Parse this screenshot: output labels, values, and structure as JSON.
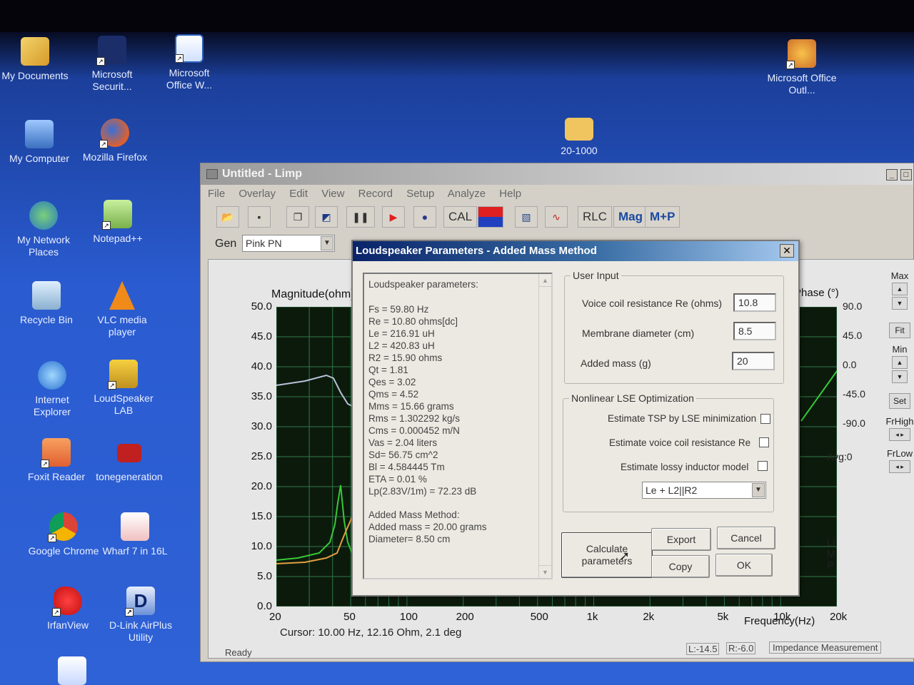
{
  "desktop": {
    "icons": [
      {
        "label": "My Documents"
      },
      {
        "label": "Microsoft Securit..."
      },
      {
        "label": "Microsoft Office W..."
      },
      {
        "label": "Microsoft Office Outl..."
      },
      {
        "label": "My Computer"
      },
      {
        "label": "Mozilla Firefox"
      },
      {
        "label": "20-1000"
      },
      {
        "label": "My Network Places"
      },
      {
        "label": "Notepad++"
      },
      {
        "label": "Recycle Bin"
      },
      {
        "label": "VLC media player"
      },
      {
        "label": "Internet Explorer"
      },
      {
        "label": "LoudSpeaker LAB"
      },
      {
        "label": "Foxit Reader"
      },
      {
        "label": "tonegeneration"
      },
      {
        "label": "Google Chrome"
      },
      {
        "label": "Wharf 7 in 16L"
      },
      {
        "label": "IrfanView"
      },
      {
        "label": "D-Link AirPlus Utility"
      }
    ]
  },
  "main_window": {
    "title": "Untitled - Limp",
    "menu": [
      "File",
      "Overlay",
      "Edit",
      "View",
      "Record",
      "Setup",
      "Analyze",
      "Help"
    ],
    "toolbar": {
      "cal": "CAL",
      "rlc": "RLC",
      "mag": "Mag",
      "mp": "M+P"
    },
    "gen_label": "Gen",
    "gen_value": "Pink PN",
    "plot": {
      "y_title": "Magnitude(ohm)",
      "phase_title": "Phase (°)",
      "y_ticks": [
        "50.0",
        "45.0",
        "40.0",
        "35.0",
        "30.0",
        "25.0",
        "20.0",
        "15.0",
        "10.0",
        "5.0",
        "0.0"
      ],
      "phase_ticks": [
        "90.0",
        "45.0",
        "0.0",
        "-45.0",
        "-90.0"
      ],
      "avg": "Avg:0",
      "x_ticks": [
        "20",
        "50",
        "100",
        "200",
        "500",
        "1k",
        "2k",
        "5k",
        "10k",
        "20k"
      ],
      "x_title": "Frequency(Hz)",
      "cursor": "Cursor: 10.00 Hz, 12.16 Ohm, 2.1 deg",
      "limp_vertical": "LIMP"
    },
    "side": {
      "max": "Max",
      "fit": "Fit",
      "min": "Min",
      "set": "Set",
      "frhigh": "FrHigh",
      "frlow": "FrLow"
    },
    "status": {
      "ready": "Ready",
      "l": "L:-14.5",
      "r": "R:-6.0",
      "mode": "Impedance Measurement"
    }
  },
  "dialog": {
    "title": "Loudspeaker Parameters - Added Mass Method",
    "close": "✕",
    "params_header": "Loudspeaker parameters:",
    "params": [
      "Fs  = 59.80 Hz",
      "Re  = 10.80 ohms[dc]",
      "Le  = 216.91 uH",
      "L2  = 420.83 uH",
      "R2  = 15.90 ohms",
      "Qt  = 1.81",
      "Qes = 3.02",
      "Qms = 4.52",
      "Mms = 15.66 grams",
      "Rms = 1.302292 kg/s",
      "Cms = 0.000452 m/N",
      "Vas = 2.04 liters",
      "Sd= 56.75 cm^2",
      "Bl  = 4.584445 Tm",
      "ETA = 0.01 %",
      "Lp(2.83V/1m) = 72.23 dB"
    ],
    "method_lines": [
      "Added Mass Method:",
      "Added mass = 20.00 grams",
      "Diameter= 8.50 cm"
    ],
    "user_input": {
      "legend": "User Input",
      "re_label": "Voice coil resistance Re (ohms)",
      "re_value": "10.8",
      "diam_label": "Membrane diameter (cm)",
      "diam_value": "8.5",
      "mass_label": "Added mass (g)",
      "mass_value": "20"
    },
    "lse": {
      "legend": "Nonlinear LSE Optimization",
      "opt1": "Estimate TSP by LSE minimization",
      "opt2": "Estimate voice coil resistance Re",
      "opt3": "Estimate lossy inductor model",
      "model": "Le + L2||R2"
    },
    "buttons": {
      "calculate": "Calculate parameters",
      "export": "Export",
      "cancel": "Cancel",
      "copy": "Copy",
      "ok": "OK"
    }
  }
}
